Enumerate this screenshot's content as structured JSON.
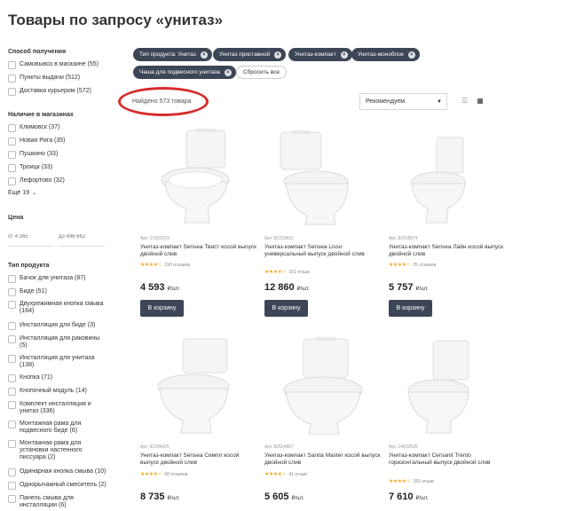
{
  "page_title": "Товары по запросу «унитаз»",
  "filters": {
    "delivery": {
      "title": "Способ получения",
      "options": [
        "Самовывоз в магазине (55)",
        "Пункты выдачи (512)",
        "Доставка курьером (572)"
      ]
    },
    "stores": {
      "title": "Наличие в магазинах",
      "options": [
        "Климовск (37)",
        "Новая Рига (35)",
        "Пушкино (33)",
        "Троицк (33)",
        "Лефортово (32)"
      ],
      "more_label": "Ещё 19"
    },
    "price": {
      "title": "Цена",
      "from_placeholder": "от 4 265",
      "to_placeholder": "до 496 662"
    },
    "product_type": {
      "title": "Тип продукта",
      "options": [
        "Бачок для унитаза (87)",
        "Биде (51)",
        "Двухрежимная кнопка смыва (164)",
        "Инсталляция для биде (3)",
        "Инсталляция для раковины (5)",
        "Инсталляция для унитаза (138)",
        "Кнопка (71)",
        "Кнопочный модуль (14)",
        "Комплект инсталляция и унитаз (336)",
        "Монтажная рама для подвесного биде (6)",
        "Монтажная рама для установки настенного писсуара  (2)",
        "Одинарная кнопка смыва (10)",
        "Однорычажный смеситель (2)",
        "Панель смыва для инсталляции (6)"
      ]
    }
  },
  "chips": [
    "Тип продукта: Унитаз",
    "Унитаз приставной",
    "Унитаз-компакт",
    "Унитаз-моноблок",
    "Чаша для подвесного унитаза"
  ],
  "reset_label": "Сбросить все",
  "found_text": "Найдено 573 товара",
  "sort_label": "Рекомендуем",
  "products": [
    {
      "sku": "Арт. 17391519",
      "name": "Унитаз-компакт Sensea Твист косой выпуск двойной слив",
      "reviews": "190 отзывов",
      "stars": "★★★★☆",
      "price": "4 593",
      "unit": "₽/шт.",
      "buy": "В корзину"
    },
    {
      "sku": "Арт. 82319831",
      "name": "Унитаз-компакт Sensea Lisso универсальный выпуск двойной слив",
      "reviews": "161 отзыв",
      "stars": "★★★★☆",
      "price": "12 860",
      "unit": "₽/шт.",
      "buy": "В корзину"
    },
    {
      "sku": "Арт. 82628974",
      "name": "Унитаз-компакт Sensea Лайн косой выпуск двойной слив",
      "reviews": "25 отзывов",
      "stars": "★★★★☆",
      "price": "5 757",
      "unit": "₽/шт.",
      "buy": "В корзину"
    },
    {
      "sku": "Арт. 82206425",
      "name": "Унитаз-компакт Sensea Симпл косой выпуск двойной слив",
      "reviews": "68 отзывов",
      "stars": "★★★★☆",
      "price": "8 735",
      "unit": "₽/шт.",
      "buy": "В корзину"
    },
    {
      "sku": "Арт. 82624807",
      "name": "Унитаз-компакт Sanita Master косой выпуск двойной слив",
      "reviews": "41 отзыв",
      "stars": "★★★★☆",
      "price": "5 605",
      "unit": "₽/шт.",
      "buy": "В корзину"
    },
    {
      "sku": "Арт. 14032626",
      "name": "Унитаз-компакт Cersanit Trento горизонтальный выпуск двойной слив",
      "reviews": "181 отзыв",
      "stars": "★★★★☆",
      "price": "7 610",
      "unit": "₽/шт.",
      "buy": "В корзину"
    }
  ],
  "colors": {
    "accent": "#3c4656",
    "highlight": "#d62b2b",
    "stars": "#f5a623"
  }
}
